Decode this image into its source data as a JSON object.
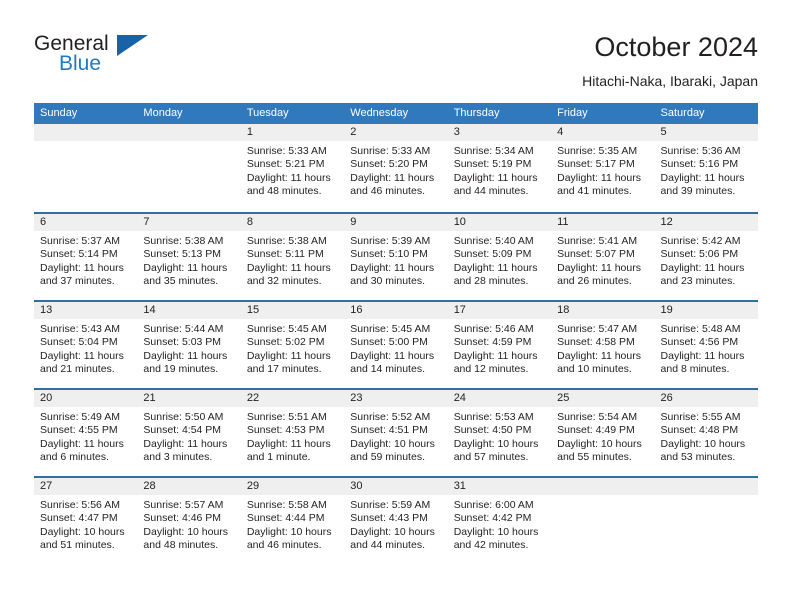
{
  "logo": {
    "word_top": "General",
    "word_bottom": "Blue",
    "triangle_icon": "triangle-icon",
    "accent_dark": "#1664a7",
    "accent_blue": "#1f7ac4"
  },
  "header": {
    "title": "October 2024",
    "subtitle": "Hitachi-Naka, Ibaraki, Japan"
  },
  "theme": {
    "header_bar": "#3079bc",
    "week_divider": "#2c6eae",
    "day_band": "#efefef",
    "text": "#231f20"
  },
  "weekdays": [
    "Sunday",
    "Monday",
    "Tuesday",
    "Wednesday",
    "Thursday",
    "Friday",
    "Saturday"
  ],
  "weeks": [
    [
      {
        "day": "",
        "sunrise": "",
        "sunset": "",
        "daylight_1": "",
        "daylight_2": ""
      },
      {
        "day": "",
        "sunrise": "",
        "sunset": "",
        "daylight_1": "",
        "daylight_2": ""
      },
      {
        "day": "1",
        "sunrise": "Sunrise: 5:33 AM",
        "sunset": "Sunset: 5:21 PM",
        "daylight_1": "Daylight: 11 hours",
        "daylight_2": "and 48 minutes."
      },
      {
        "day": "2",
        "sunrise": "Sunrise: 5:33 AM",
        "sunset": "Sunset: 5:20 PM",
        "daylight_1": "Daylight: 11 hours",
        "daylight_2": "and 46 minutes."
      },
      {
        "day": "3",
        "sunrise": "Sunrise: 5:34 AM",
        "sunset": "Sunset: 5:19 PM",
        "daylight_1": "Daylight: 11 hours",
        "daylight_2": "and 44 minutes."
      },
      {
        "day": "4",
        "sunrise": "Sunrise: 5:35 AM",
        "sunset": "Sunset: 5:17 PM",
        "daylight_1": "Daylight: 11 hours",
        "daylight_2": "and 41 minutes."
      },
      {
        "day": "5",
        "sunrise": "Sunrise: 5:36 AM",
        "sunset": "Sunset: 5:16 PM",
        "daylight_1": "Daylight: 11 hours",
        "daylight_2": "and 39 minutes."
      }
    ],
    [
      {
        "day": "6",
        "sunrise": "Sunrise: 5:37 AM",
        "sunset": "Sunset: 5:14 PM",
        "daylight_1": "Daylight: 11 hours",
        "daylight_2": "and 37 minutes."
      },
      {
        "day": "7",
        "sunrise": "Sunrise: 5:38 AM",
        "sunset": "Sunset: 5:13 PM",
        "daylight_1": "Daylight: 11 hours",
        "daylight_2": "and 35 minutes."
      },
      {
        "day": "8",
        "sunrise": "Sunrise: 5:38 AM",
        "sunset": "Sunset: 5:11 PM",
        "daylight_1": "Daylight: 11 hours",
        "daylight_2": "and 32 minutes."
      },
      {
        "day": "9",
        "sunrise": "Sunrise: 5:39 AM",
        "sunset": "Sunset: 5:10 PM",
        "daylight_1": "Daylight: 11 hours",
        "daylight_2": "and 30 minutes."
      },
      {
        "day": "10",
        "sunrise": "Sunrise: 5:40 AM",
        "sunset": "Sunset: 5:09 PM",
        "daylight_1": "Daylight: 11 hours",
        "daylight_2": "and 28 minutes."
      },
      {
        "day": "11",
        "sunrise": "Sunrise: 5:41 AM",
        "sunset": "Sunset: 5:07 PM",
        "daylight_1": "Daylight: 11 hours",
        "daylight_2": "and 26 minutes."
      },
      {
        "day": "12",
        "sunrise": "Sunrise: 5:42 AM",
        "sunset": "Sunset: 5:06 PM",
        "daylight_1": "Daylight: 11 hours",
        "daylight_2": "and 23 minutes."
      }
    ],
    [
      {
        "day": "13",
        "sunrise": "Sunrise: 5:43 AM",
        "sunset": "Sunset: 5:04 PM",
        "daylight_1": "Daylight: 11 hours",
        "daylight_2": "and 21 minutes."
      },
      {
        "day": "14",
        "sunrise": "Sunrise: 5:44 AM",
        "sunset": "Sunset: 5:03 PM",
        "daylight_1": "Daylight: 11 hours",
        "daylight_2": "and 19 minutes."
      },
      {
        "day": "15",
        "sunrise": "Sunrise: 5:45 AM",
        "sunset": "Sunset: 5:02 PM",
        "daylight_1": "Daylight: 11 hours",
        "daylight_2": "and 17 minutes."
      },
      {
        "day": "16",
        "sunrise": "Sunrise: 5:45 AM",
        "sunset": "Sunset: 5:00 PM",
        "daylight_1": "Daylight: 11 hours",
        "daylight_2": "and 14 minutes."
      },
      {
        "day": "17",
        "sunrise": "Sunrise: 5:46 AM",
        "sunset": "Sunset: 4:59 PM",
        "daylight_1": "Daylight: 11 hours",
        "daylight_2": "and 12 minutes."
      },
      {
        "day": "18",
        "sunrise": "Sunrise: 5:47 AM",
        "sunset": "Sunset: 4:58 PM",
        "daylight_1": "Daylight: 11 hours",
        "daylight_2": "and 10 minutes."
      },
      {
        "day": "19",
        "sunrise": "Sunrise: 5:48 AM",
        "sunset": "Sunset: 4:56 PM",
        "daylight_1": "Daylight: 11 hours",
        "daylight_2": "and 8 minutes."
      }
    ],
    [
      {
        "day": "20",
        "sunrise": "Sunrise: 5:49 AM",
        "sunset": "Sunset: 4:55 PM",
        "daylight_1": "Daylight: 11 hours",
        "daylight_2": "and 6 minutes."
      },
      {
        "day": "21",
        "sunrise": "Sunrise: 5:50 AM",
        "sunset": "Sunset: 4:54 PM",
        "daylight_1": "Daylight: 11 hours",
        "daylight_2": "and 3 minutes."
      },
      {
        "day": "22",
        "sunrise": "Sunrise: 5:51 AM",
        "sunset": "Sunset: 4:53 PM",
        "daylight_1": "Daylight: 11 hours",
        "daylight_2": "and 1 minute."
      },
      {
        "day": "23",
        "sunrise": "Sunrise: 5:52 AM",
        "sunset": "Sunset: 4:51 PM",
        "daylight_1": "Daylight: 10 hours",
        "daylight_2": "and 59 minutes."
      },
      {
        "day": "24",
        "sunrise": "Sunrise: 5:53 AM",
        "sunset": "Sunset: 4:50 PM",
        "daylight_1": "Daylight: 10 hours",
        "daylight_2": "and 57 minutes."
      },
      {
        "day": "25",
        "sunrise": "Sunrise: 5:54 AM",
        "sunset": "Sunset: 4:49 PM",
        "daylight_1": "Daylight: 10 hours",
        "daylight_2": "and 55 minutes."
      },
      {
        "day": "26",
        "sunrise": "Sunrise: 5:55 AM",
        "sunset": "Sunset: 4:48 PM",
        "daylight_1": "Daylight: 10 hours",
        "daylight_2": "and 53 minutes."
      }
    ],
    [
      {
        "day": "27",
        "sunrise": "Sunrise: 5:56 AM",
        "sunset": "Sunset: 4:47 PM",
        "daylight_1": "Daylight: 10 hours",
        "daylight_2": "and 51 minutes."
      },
      {
        "day": "28",
        "sunrise": "Sunrise: 5:57 AM",
        "sunset": "Sunset: 4:46 PM",
        "daylight_1": "Daylight: 10 hours",
        "daylight_2": "and 48 minutes."
      },
      {
        "day": "29",
        "sunrise": "Sunrise: 5:58 AM",
        "sunset": "Sunset: 4:44 PM",
        "daylight_1": "Daylight: 10 hours",
        "daylight_2": "and 46 minutes."
      },
      {
        "day": "30",
        "sunrise": "Sunrise: 5:59 AM",
        "sunset": "Sunset: 4:43 PM",
        "daylight_1": "Daylight: 10 hours",
        "daylight_2": "and 44 minutes."
      },
      {
        "day": "31",
        "sunrise": "Sunrise: 6:00 AM",
        "sunset": "Sunset: 4:42 PM",
        "daylight_1": "Daylight: 10 hours",
        "daylight_2": "and 42 minutes."
      },
      {
        "day": "",
        "sunrise": "",
        "sunset": "",
        "daylight_1": "",
        "daylight_2": ""
      },
      {
        "day": "",
        "sunrise": "",
        "sunset": "",
        "daylight_1": "",
        "daylight_2": ""
      }
    ]
  ]
}
